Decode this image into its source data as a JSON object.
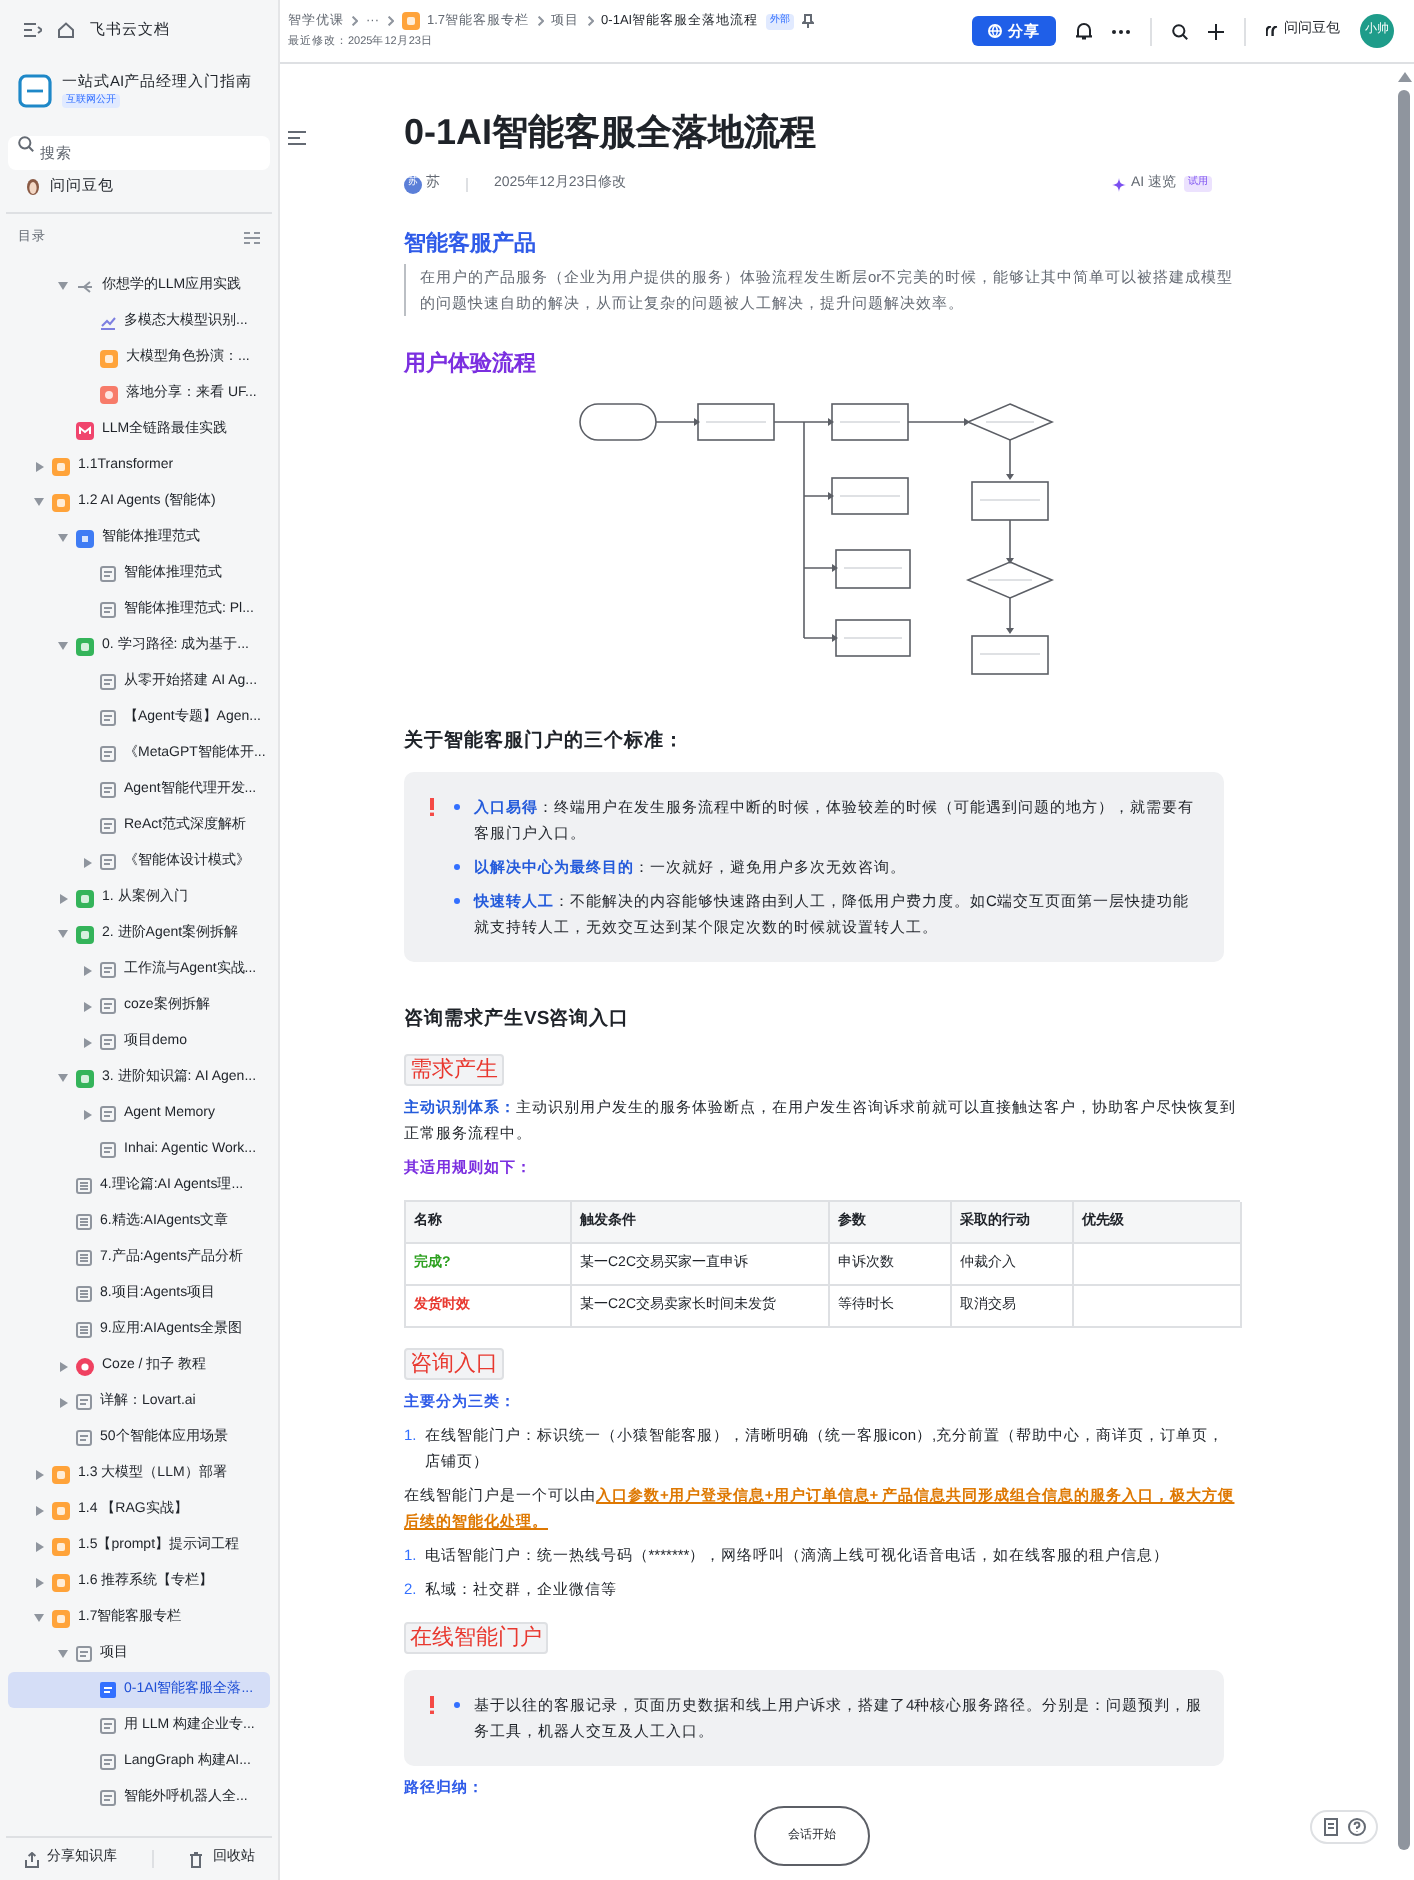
{
  "sidebar": {
    "app_name": "飞书云文档",
    "space": {
      "name": "一站式AI产品经理入门指南",
      "badge": "互联网公开"
    },
    "search": {
      "placeholder": "搜索"
    },
    "assistant": "问问豆包",
    "outline": {
      "title": "目录",
      "continued": [
        {
          "label": "你想学的LLM应用实践",
          "kind": "mind",
          "expanded": true,
          "selected": false,
          "children": [
            {
              "label": "多模态大模型识别...",
              "kind": "chart",
              "selected": false
            },
            {
              "label": "大模型角色扮演：...",
              "kind": "orange",
              "selected": false
            },
            {
              "label": "落地分享：来看 UF...",
              "kind": "salmon",
              "selected": false
            }
          ]
        },
        {
          "label": "LLM全链路最佳实践",
          "kind": "pink",
          "selected": false
        }
      ],
      "items": [
        {
          "label": "1.1Transformer",
          "kind": "orange",
          "expanded": false,
          "selected": false
        },
        {
          "label": "1.2 AI Agents (智能体)",
          "kind": "orange",
          "expanded": true,
          "selected": false,
          "children": [
            {
              "label": "智能体推理范式",
              "kind": "blue",
              "expanded": true,
              "selected": false,
              "children": [
                {
                  "label": "智能体推理范式",
                  "kind": "doc",
                  "selected": false
                },
                {
                  "label": "智能体推理范式: Pl...",
                  "kind": "doc",
                  "selected": false
                }
              ]
            },
            {
              "label": "0. 学习路径: 成为基于...",
              "kind": "green",
              "expanded": true,
              "selected": false,
              "children": [
                {
                  "label": "从零开始搭建 AI Ag...",
                  "kind": "doc",
                  "selected": false
                },
                {
                  "label": "【Agent专题】Agen...",
                  "kind": "doc",
                  "selected": false
                },
                {
                  "label": "《MetaGPT智能体开...",
                  "kind": "doc",
                  "selected": false
                },
                {
                  "label": "Agent智能代理开发...",
                  "kind": "doc",
                  "selected": false
                },
                {
                  "label": "ReAct范式深度解析",
                  "kind": "doc",
                  "selected": false
                },
                {
                  "label": "《智能体设计模式》",
                  "kind": "doc",
                  "expanded": false,
                  "selected": false
                }
              ]
            },
            {
              "label": "1. 从案例入门",
              "kind": "green",
              "expanded": false,
              "selected": false
            },
            {
              "label": "2. 进阶Agent案例拆解",
              "kind": "green",
              "expanded": true,
              "selected": false,
              "children": [
                {
                  "label": "工作流与Agent实战...",
                  "kind": "doc",
                  "expanded": false,
                  "selected": false
                },
                {
                  "label": "coze案例拆解",
                  "kind": "doc",
                  "expanded": false,
                  "selected": false
                },
                {
                  "label": "项目demo",
                  "kind": "doc",
                  "expanded": false,
                  "selected": false
                }
              ]
            },
            {
              "label": "3. 进阶知识篇: AI Agen...",
              "kind": "green",
              "expanded": true,
              "selected": false,
              "children": [
                {
                  "label": "Agent Memory",
                  "kind": "doc",
                  "expanded": false,
                  "selected": false
                },
                {
                  "label": "Inhai: Agentic Work...",
                  "kind": "doc",
                  "selected": false
                }
              ]
            },
            {
              "label": "4.理论篇:AI Agents理...",
              "kind": "board",
              "selected": false
            },
            {
              "label": "6.精选:AIAgents文章",
              "kind": "board",
              "selected": false
            },
            {
              "label": "7.产品:Agents产品分析",
              "kind": "board",
              "selected": false
            },
            {
              "label": "8.项目:Agents项目",
              "kind": "board",
              "selected": false
            },
            {
              "label": "9.应用:AIAgents全景图",
              "kind": "board",
              "selected": false
            },
            {
              "label": "Coze / 扣子 教程",
              "kind": "red",
              "expanded": false,
              "selected": false
            },
            {
              "label": "详解：Lovart.ai",
              "kind": "doc",
              "expanded": false,
              "selected": false
            },
            {
              "label": "50个智能体应用场景",
              "kind": "doc",
              "selected": false
            }
          ]
        },
        {
          "label": "1.3 大模型（LLM）部署",
          "kind": "orange",
          "expanded": false,
          "selected": false
        },
        {
          "label": "1.4 【RAG实战】",
          "kind": "orange",
          "expanded": false,
          "selected": false
        },
        {
          "label": "1.5【prompt】提示词工程",
          "kind": "orange",
          "expanded": false,
          "selected": false
        },
        {
          "label": "1.6 推荐系统【专栏】",
          "kind": "orange",
          "expanded": false,
          "selected": false
        },
        {
          "label": "1.7智能客服专栏",
          "kind": "orange",
          "expanded": true,
          "selected": false,
          "children": [
            {
              "label": "项目",
              "kind": "doc",
              "expanded": true,
              "selected": false,
              "children": [
                {
                  "label": "0-1AI智能客服全落...",
                  "kind": "doc",
                  "selected": true
                },
                {
                  "label": "用 LLM 构建企业专...",
                  "kind": "doc",
                  "selected": false
                },
                {
                  "label": "LangGraph 构建AI...",
                  "kind": "doc",
                  "selected": false
                },
                {
                  "label": "智能外呼机器人全...",
                  "kind": "doc",
                  "selected": false
                }
              ]
            }
          ]
        }
      ]
    },
    "footer": [
      "分享知识库",
      "回收站"
    ]
  },
  "topbar": {
    "breadcrumbs": [
      {
        "label": "智学优课"
      },
      {
        "label": "···"
      },
      {
        "label": "1.7智能客服专栏",
        "kind": "orange"
      },
      {
        "label": "项目"
      },
      {
        "label": "0-1AI智能客服全落地流程"
      }
    ],
    "badge": "外部",
    "last_modified": "最近修改：2025年12月23日",
    "share": "分享",
    "assistant": "问问豆包",
    "avatar": "小帅"
  },
  "document": {
    "title": "0-1AI智能客服全落地流程",
    "author_initial": "苏",
    "author": "苏",
    "modified": "2025年12月23日修改",
    "ai": "AI 速览",
    "ai_badge": "试用",
    "blocks": [
      {
        "kind": "heading",
        "text": "智能客服产品",
        "color": "#2f5be8"
      },
      {
        "kind": "quote",
        "text": "在用户的产品服务（企业为用户提供的服务）体验流程发生断层or不完美的时候，能够让其中简单可以被搭建成模型的问题快速自助的解决，从而让复杂的问题被人工解决，提升问题解决效率。"
      },
      {
        "kind": "heading",
        "text": "用户体验流程",
        "color": "#7b2fe0"
      },
      {
        "kind": "flowchart"
      },
      {
        "kind": "subheading",
        "text": "关于智能客服门户的三个标准："
      },
      {
        "kind": "callout",
        "items": [
          {
            "lead": "入口易得",
            "text": "：终端用户在发生服务流程中断的时候，体验较差的时候（可能遇到问题的地方），就需要有客服门户入口。"
          },
          {
            "lead": "以解决中心为最终目的",
            "text": "：一次就好，避免用户多次无效咨询。"
          },
          {
            "lead": "快速转人工",
            "text": "：不能解决的内容能够快速路由到人工，降低用户费力度。如C端交互页面第一层快捷功能就支持转人工，无效交互达到某个限定次数的时候就设置转人工。"
          }
        ]
      },
      {
        "kind": "subheading",
        "text": "咨询需求产生VS咨询入口"
      },
      {
        "kind": "tag",
        "text": "需求产生"
      },
      {
        "kind": "paragraph",
        "lead": "主动识别体系：",
        "text": "主动识别用户发生的服务体验断点，在用户发生咨询诉求前就可以直接触达客户，协助客户尽快恢复到正常服务流程中。"
      },
      {
        "kind": "label",
        "text": "其适用规则如下：",
        "color": "#7b2fe0"
      },
      {
        "kind": "table",
        "columns": [
          "名称",
          "触发条件",
          "参数",
          "采取的行动",
          "优先级"
        ],
        "rows": [
          {
            "color": "#2ea121",
            "cells": [
              "完成?",
              "某一C2C交易买家一直申诉",
              "申诉次数",
              "仲裁介入"
            ]
          },
          {
            "color": "#e8382f",
            "cells": [
              "发货时效",
              "某一C2C交易卖家长时间未发货",
              "等待时长",
              "取消交易"
            ]
          }
        ]
      },
      {
        "kind": "tag",
        "text": "咨询入口"
      },
      {
        "kind": "label",
        "text": "主要分为三类：",
        "color": "#2f5be8"
      },
      {
        "kind": "numbered",
        "number": "1.",
        "text": "在线智能门户：标识统一（小猿智能客服），清晰明确（统一客服icon）,充分前置（帮助中心，商详页，订单页，店铺页）"
      },
      {
        "kind": "paragraph",
        "text": "在线智能门户是一个可以由",
        "highlight": "入口参数+用户登录信息+用户订单信息+ 产品信息共同形成组合信息的服务入口，极大方便后续的智能化处理。"
      },
      {
        "kind": "numbered",
        "number": "1.",
        "text": "电话智能门户：统一热线号码（*******），网络呼叫（滴滴上线可视化语音电话，如在线客服的租户信息）"
      },
      {
        "kind": "numbered",
        "number": "2.",
        "text": "私域：社交群，企业微信等"
      },
      {
        "kind": "tag",
        "text": "在线智能门户"
      },
      {
        "kind": "callout",
        "items": [
          {
            "text": "基于以往的客服记录，页面历史数据和线上用户诉求，搭建了4种核心服务路径。分别是：问题预判，服务工具，机器人交互及人工入口。"
          }
        ]
      },
      {
        "kind": "label",
        "text": "路径归纳：",
        "color": "#2f5be8"
      },
      {
        "kind": "flow_node",
        "text": "会话开始"
      }
    ]
  }
}
